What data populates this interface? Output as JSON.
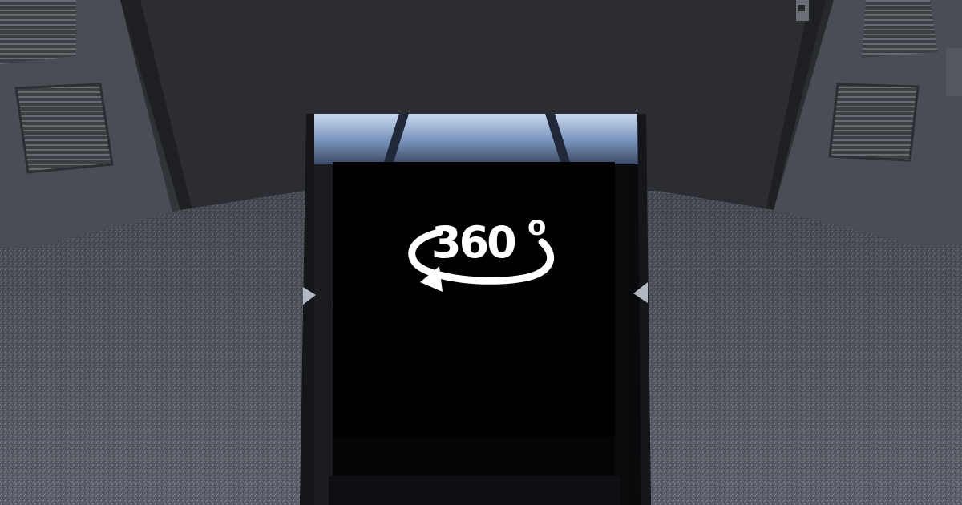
{
  "scene": {
    "kind": "3d-rendered-room",
    "wall_color": "#2e3035",
    "floor_color": "#5a5e68",
    "door_color": "#4a4d53",
    "kiosk_color": "#0a0b0d",
    "screen_color": "#000000",
    "reflection_color": "#9fb6d6"
  },
  "badge": {
    "icon": "rotate-360-icon",
    "number": "360",
    "degree": "o",
    "color": "#ffffff"
  }
}
